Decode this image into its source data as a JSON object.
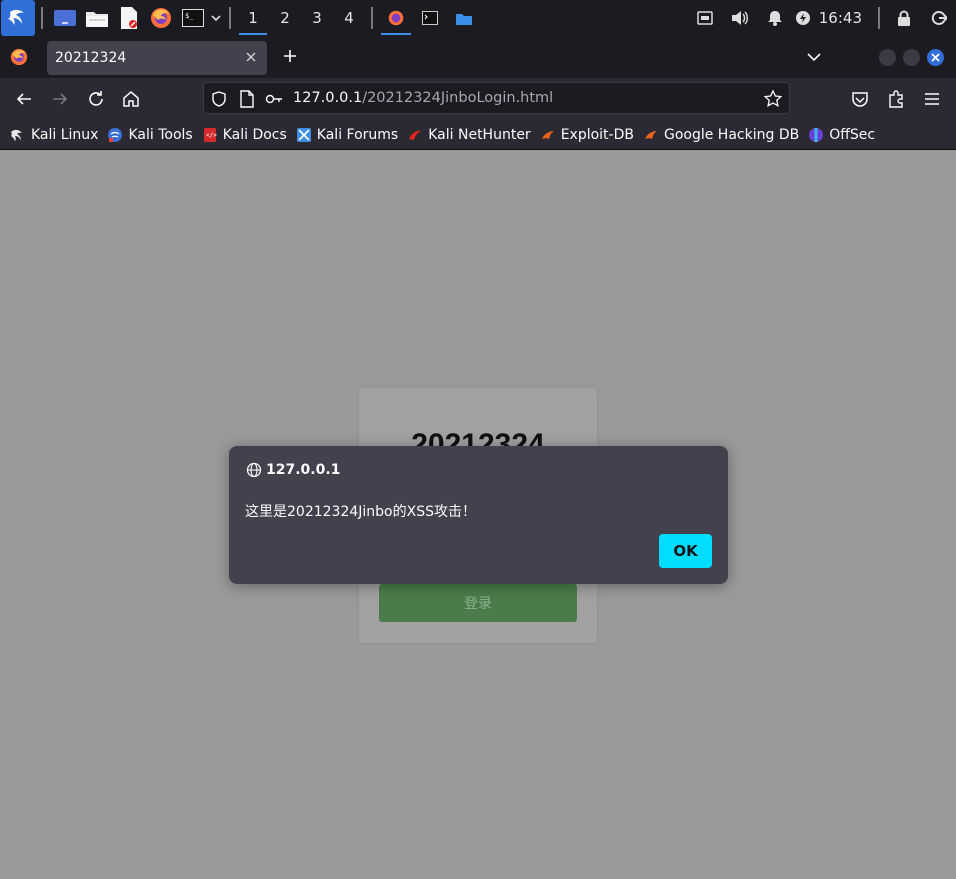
{
  "panel": {
    "workspaces": [
      "1",
      "2",
      "3",
      "4"
    ],
    "active_workspace": "1",
    "clock": "16:43"
  },
  "browser": {
    "tab_title": "20212324",
    "url_host": "127.0.0.1",
    "url_path": "/20212324JinboLogin.html",
    "bookmarks": [
      {
        "label": "Kali Linux",
        "icon": "kali-dragon-icon"
      },
      {
        "label": "Kali Tools",
        "icon": "kali-tools-icon"
      },
      {
        "label": "Kali Docs",
        "icon": "kali-docs-icon"
      },
      {
        "label": "Kali Forums",
        "icon": "kali-forums-icon"
      },
      {
        "label": "Kali NetHunter",
        "icon": "nethunter-icon"
      },
      {
        "label": "Exploit-DB",
        "icon": "exploit-db-icon"
      },
      {
        "label": "Google Hacking DB",
        "icon": "ghdb-icon"
      },
      {
        "label": "OffSec",
        "icon": "offsec-icon"
      }
    ]
  },
  "page": {
    "card_title": "20212324",
    "login_button": "登录"
  },
  "dialog": {
    "origin": "127.0.0.1",
    "message": "这里是20212324Jinbo的XSS攻击！",
    "ok_label": "OK",
    "accent": "#00ddff"
  }
}
